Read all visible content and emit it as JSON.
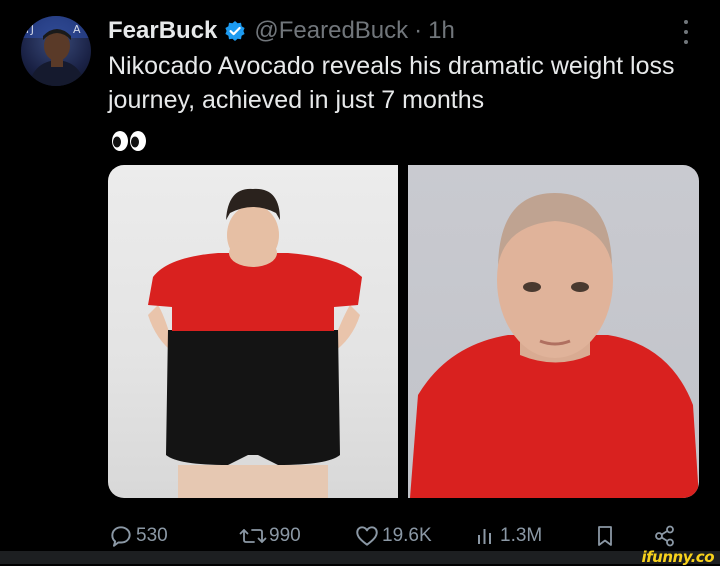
{
  "author": {
    "display_name": "FearBuck",
    "handle": "@FearedBuck",
    "time": "1h",
    "verified": true,
    "avatar_icon": "profile-photo"
  },
  "tweet": {
    "text": "Nikocado Avocado reveals his dramatic weight loss journey, achieved in just 7 months",
    "emoji": "eyes-emoji"
  },
  "media": {
    "images": [
      {
        "name": "before-photo"
      },
      {
        "name": "after-photo"
      }
    ]
  },
  "metrics": {
    "replies": "530",
    "reposts": "990",
    "likes": "19.6K",
    "views": "1.3M"
  },
  "watermark": "ifunny.co",
  "colors": {
    "background": "#000000",
    "text": "#e7e9ea",
    "muted": "#71767b",
    "verified_blue": "#1d9bf0",
    "shirt_red": "#d9211f",
    "watermark_yellow": "#f8d21c"
  }
}
